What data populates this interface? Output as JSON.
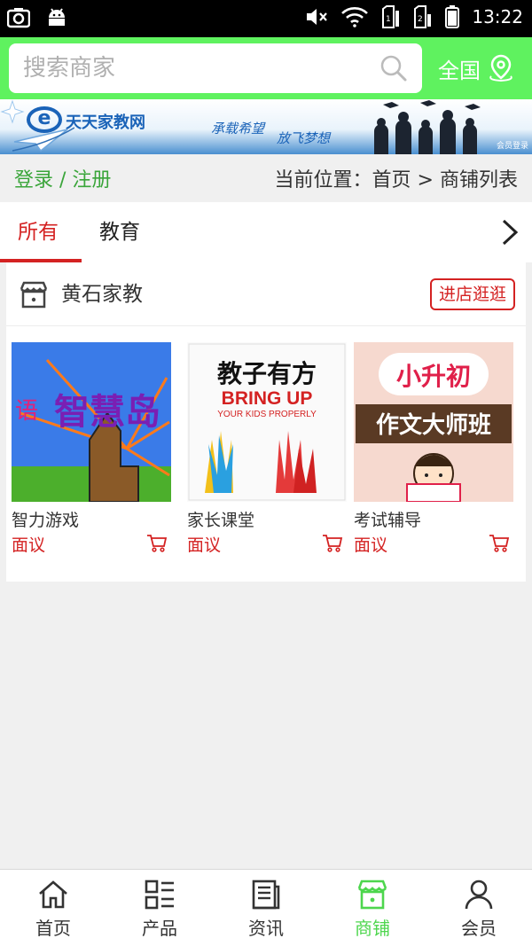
{
  "status_bar": {
    "time": "13:22"
  },
  "header": {
    "search_placeholder": "搜索商家",
    "region_label": "全国"
  },
  "banner": {
    "site_name": "天天家教网",
    "slogan_1": "承载希望",
    "slogan_2": "放飞梦想",
    "member_login": "会员登录"
  },
  "breadcrumb": {
    "login": "登录",
    "separator": " / ",
    "register": "注册",
    "location_prefix": "当前位置：",
    "home": "首页",
    "arrow": " > ",
    "current": "商铺列表"
  },
  "tabs": [
    {
      "label": "所有",
      "active": true
    },
    {
      "label": "教育",
      "active": false
    }
  ],
  "shop": {
    "name": "黄石家教",
    "enter_button": "进店逛逛",
    "products": [
      {
        "name": "智力游戏",
        "price": "面议",
        "cover_text": "智慧岛"
      },
      {
        "name": "家长课堂",
        "price": "面议",
        "cover_title": "教子有方",
        "cover_en_1": "BRING UP",
        "cover_en_2": "YOUR KIDS PROPERLY"
      },
      {
        "name": "考试辅导",
        "price": "面议",
        "cover_title": "小升初",
        "cover_sub": "作文大师班"
      }
    ]
  },
  "bottom_nav": [
    {
      "label": "首页",
      "icon": "home-icon"
    },
    {
      "label": "产品",
      "icon": "grid-list-icon"
    },
    {
      "label": "资讯",
      "icon": "news-icon"
    },
    {
      "label": "商铺",
      "icon": "store-icon",
      "active": true
    },
    {
      "label": "会员",
      "icon": "user-icon"
    }
  ],
  "colors": {
    "brand_green": "#5ff25f",
    "active_red": "#d42222",
    "nav_active": "#4dd64d"
  }
}
